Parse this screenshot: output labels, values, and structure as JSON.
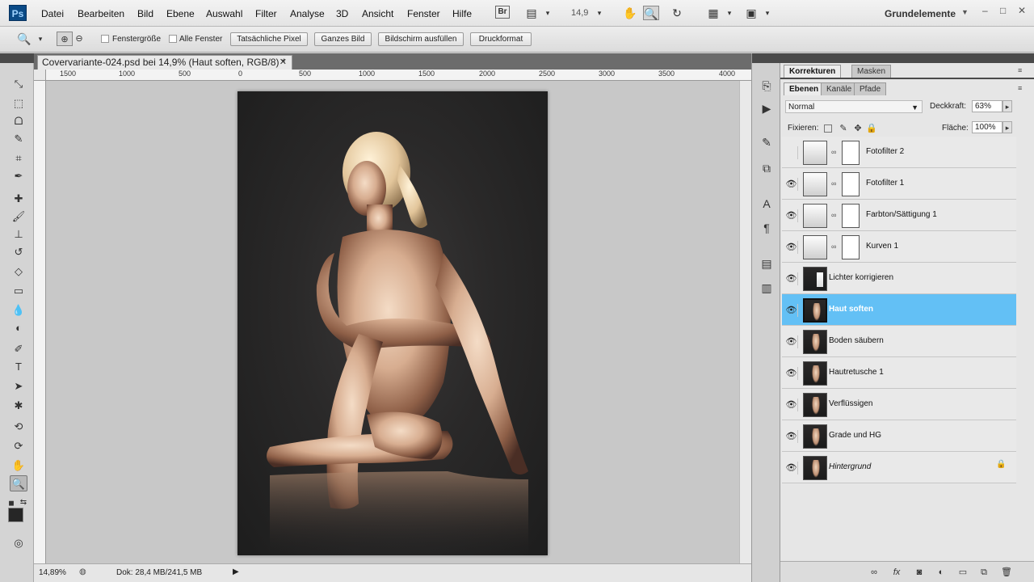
{
  "menubar": {
    "logo": "Ps",
    "items": [
      "Datei",
      "Bearbeiten",
      "Bild",
      "Ebene",
      "Auswahl",
      "Filter",
      "Analyse",
      "3D",
      "Ansicht",
      "Fenster",
      "Hilfe"
    ],
    "bridge_label": "Br",
    "zoom": "14,9",
    "workspace": "Grundelemente"
  },
  "options_bar": {
    "checkbox_fit_window": "Fenstergröße",
    "checkbox_all_windows": "Alle Fenster",
    "btn_actual_pixels": "Tatsächliche Pixel",
    "btn_fit_screen": "Ganzes Bild",
    "btn_fill_screen": "Bildschirm ausfüllen",
    "btn_print_size": "Druckformat"
  },
  "document": {
    "tab_title": "Covervariante-024.psd bei 14,9% (Haut soften, RGB/8) *",
    "ruler_labels": [
      "1500",
      "1000",
      "500",
      "0",
      "500",
      "1000",
      "1500",
      "2000",
      "2500",
      "3000",
      "3500",
      "4000"
    ],
    "zoom_status": "14,89%",
    "doc_info": "Dok: 28,4 MB/241,5 MB"
  },
  "panels": {
    "top_tabs": [
      "Korrekturen",
      "Masken"
    ],
    "layer_tabs": [
      "Ebenen",
      "Kanäle",
      "Pfade"
    ],
    "blend_mode": "Normal",
    "opacity_label": "Deckkraft:",
    "opacity_value": "63%",
    "lock_label": "Fixieren:",
    "fill_label": "Fläche:",
    "fill_value": "100%",
    "layers": [
      {
        "name": "Fotofilter 2",
        "type": "adjustment",
        "visible": false,
        "selected": false
      },
      {
        "name": "Fotofilter 1",
        "type": "adjustment",
        "visible": true,
        "selected": false
      },
      {
        "name": "Farbton/Sättigung 1",
        "type": "adjustment",
        "visible": true,
        "selected": false
      },
      {
        "name": "Kurven 1",
        "type": "adjustment",
        "visible": true,
        "selected": false
      },
      {
        "name": "Lichter korrigieren",
        "type": "pixel",
        "visible": true,
        "selected": false
      },
      {
        "name": "Haut soften",
        "type": "pixel",
        "visible": true,
        "selected": true
      },
      {
        "name": "Boden säubern",
        "type": "pixel",
        "visible": true,
        "selected": false
      },
      {
        "name": "Hautretusche 1",
        "type": "pixel",
        "visible": true,
        "selected": false
      },
      {
        "name": "Verflüssigen",
        "type": "pixel",
        "visible": true,
        "selected": false
      },
      {
        "name": "Grade und HG",
        "type": "pixel",
        "visible": true,
        "selected": false
      },
      {
        "name": "Hintergrund",
        "type": "background",
        "visible": true,
        "selected": false
      }
    ]
  },
  "colors": {
    "selection_highlight": "#63c0f5",
    "foreground_color": "#262626"
  }
}
